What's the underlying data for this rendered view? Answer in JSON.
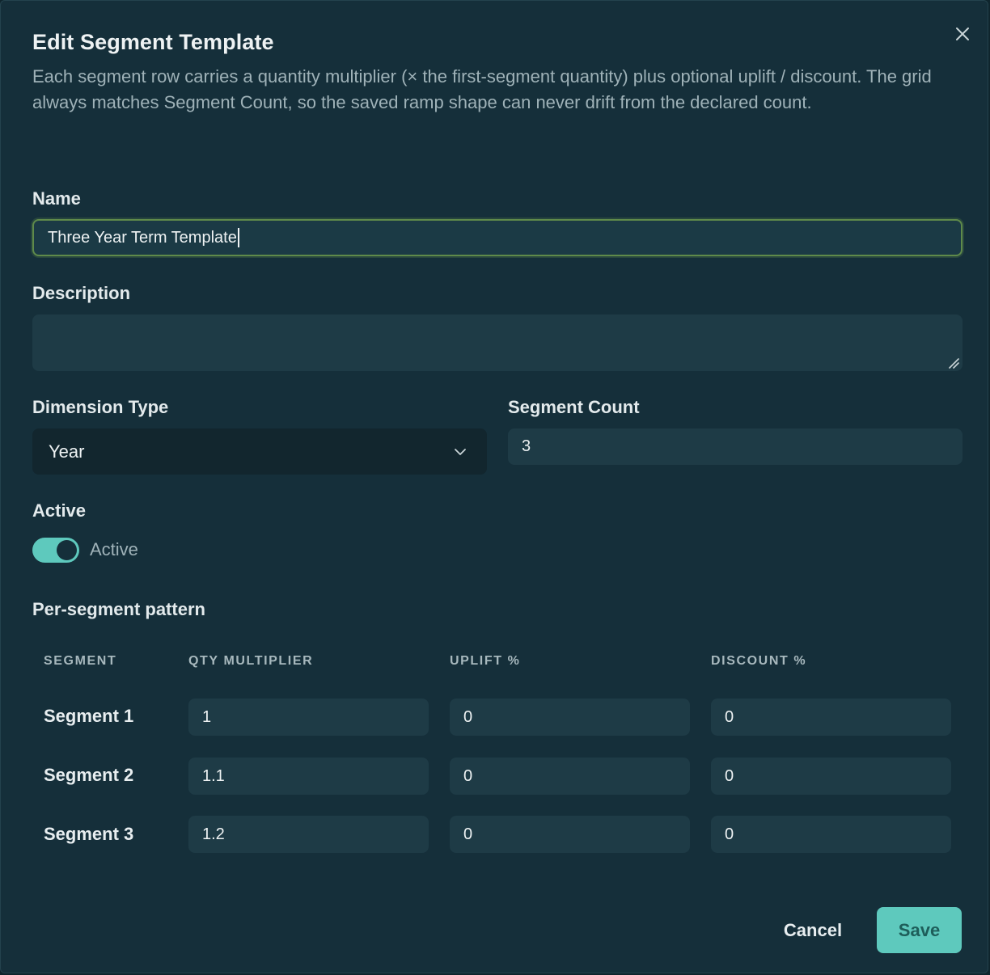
{
  "dialog": {
    "title": "Edit Segment Template",
    "subtitle": "Each segment row carries a quantity multiplier (× the first-segment quantity) plus optional uplift / discount. The grid always matches Segment Count, so the saved ramp shape can never drift from the declared count."
  },
  "form": {
    "name_label": "Name",
    "name_value": "Three Year Term Template",
    "description_label": "Description",
    "description_value": "",
    "dimension_label": "Dimension Type",
    "dimension_value": "Year",
    "count_label": "Segment Count",
    "count_value": "3",
    "active_label": "Active",
    "active_toggle_label": "Active",
    "active_on": true
  },
  "pattern": {
    "heading": "Per-segment pattern",
    "columns": [
      "SEGMENT",
      "QTY MULTIPLIER",
      "UPLIFT %",
      "DISCOUNT %"
    ],
    "rows": [
      {
        "segment": "Segment 1",
        "qty": "1",
        "uplift": "0",
        "discount": "0"
      },
      {
        "segment": "Segment 2",
        "qty": "1.1",
        "uplift": "0",
        "discount": "0"
      },
      {
        "segment": "Segment 3",
        "qty": "1.2",
        "uplift": "0",
        "discount": "0"
      }
    ]
  },
  "footer": {
    "cancel_label": "Cancel",
    "save_label": "Save"
  },
  "colors": {
    "accent": "#5ec9bd",
    "background": "#152f3a",
    "input_bg": "#1e3b46",
    "focus_border": "#5f8a4a"
  },
  "icons": {
    "close": "close-icon",
    "dropdown": "chevron-down-icon",
    "resize": "resize-handle-icon"
  }
}
